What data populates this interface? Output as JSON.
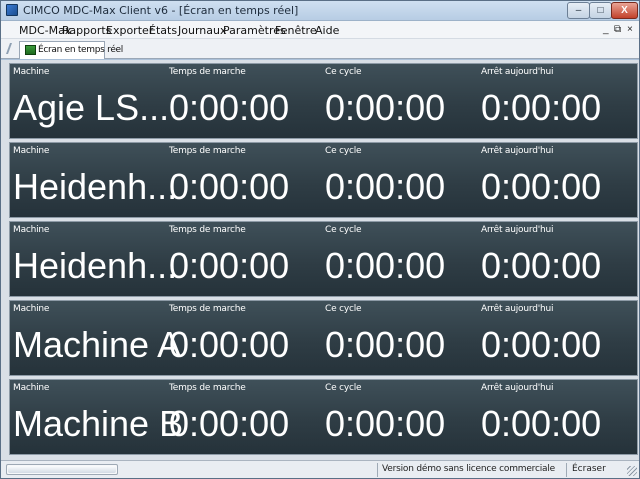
{
  "window": {
    "title": "CIMCO MDC-Max Client v6 - [Écran en temps réel]",
    "minimize_label": "–",
    "maximize_label": "□",
    "close_label": "X"
  },
  "menu": {
    "items": [
      "MDC-Max",
      "Rapports",
      "Exporter",
      "États",
      "Journaux",
      "Paramètres",
      "Fenêtre",
      "Aide"
    ],
    "mdi_minimize": "_",
    "mdi_restore": "⧉",
    "mdi_close": "×"
  },
  "tabs": {
    "realtime_label": "Écran en temps réel"
  },
  "columns": [
    "Machine",
    "Temps de marche",
    "Ce cycle",
    "Arrêt aujourd'hui"
  ],
  "machines": [
    {
      "name": "Agie LS...",
      "run_time": "0:00:00",
      "cycle": "0:00:00",
      "stop_today": "0:00:00"
    },
    {
      "name": "Heidenh...",
      "run_time": "0:00:00",
      "cycle": "0:00:00",
      "stop_today": "0:00:00"
    },
    {
      "name": "Heidenh...",
      "run_time": "0:00:00",
      "cycle": "0:00:00",
      "stop_today": "0:00:00"
    },
    {
      "name": "Machine A",
      "run_time": "0:00:00",
      "cycle": "0:00:00",
      "stop_today": "0:00:00"
    },
    {
      "name": "Machine B",
      "run_time": "0:00:00",
      "cycle": "0:00:00",
      "stop_today": "0:00:00"
    }
  ],
  "status": {
    "licence": "Version démo sans licence commerciale",
    "clear": "Écraser"
  },
  "colors": {
    "panel_bg": "#2f3d45",
    "panel_text": "#ffffff",
    "window_frame": "#aac0d8"
  }
}
